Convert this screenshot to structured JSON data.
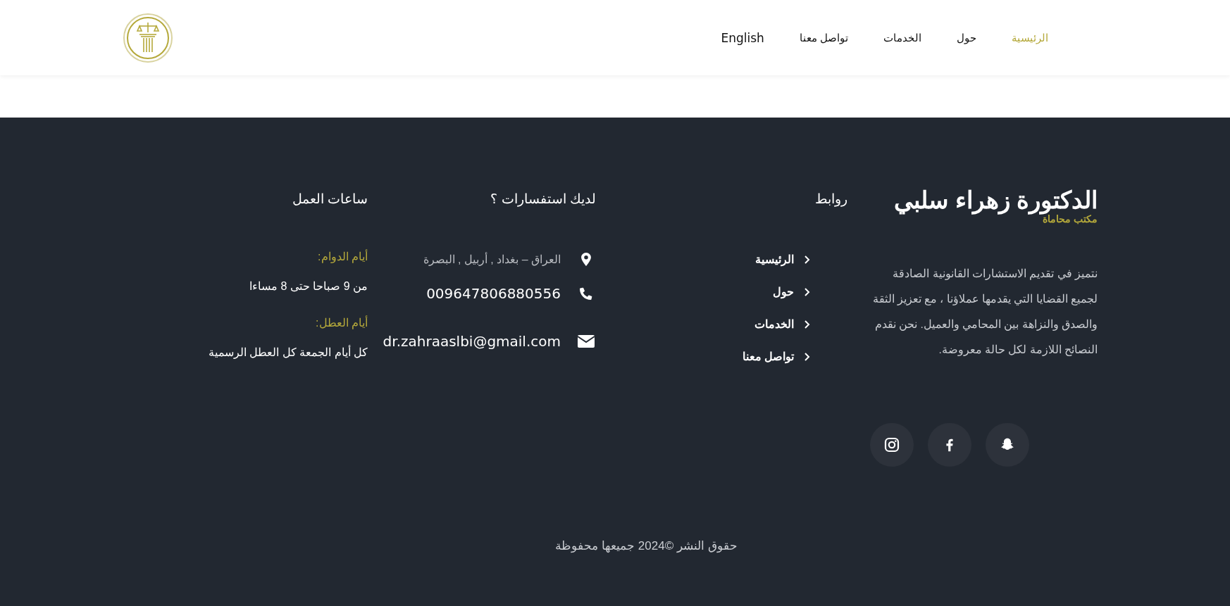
{
  "nav": {
    "items": [
      {
        "label": "الرئيسية",
        "selected": true
      },
      {
        "label": "حول",
        "selected": false
      },
      {
        "label": "الخدمات",
        "selected": false
      },
      {
        "label": "تواصل معنا",
        "selected": false
      },
      {
        "label": "English",
        "selected": false
      }
    ]
  },
  "brand": {
    "title": "الدكتورة زهراء سلبي",
    "subtitle": "مكتب محاماة",
    "description": "نتميز في تقديم الاستشارات القانونية الصادقة لجميع القضايا التي يقدمها عملاؤنا ، مع تعزيز الثقة والصدق والنزاهة بين المحامي والعميل. نحن نقدم النصائح اللازمة لكل حالة معروضة.",
    "socials": [
      {
        "kind": "snapchat"
      },
      {
        "kind": "facebook"
      },
      {
        "kind": "instagram"
      }
    ]
  },
  "links": {
    "heading": "روابط",
    "items": [
      "الرئيسية",
      "حول",
      "الخدمات",
      "تواصل معنا"
    ]
  },
  "contact": {
    "heading": "لديك استفسارات ؟",
    "items": [
      {
        "kind": "location",
        "text": "العراق – بغداد , أربيل , البصرة"
      },
      {
        "kind": "phone",
        "text": "009647806880556"
      },
      {
        "kind": "email",
        "text": "dr.zahraaslbi@gmail.com"
      }
    ]
  },
  "hours": {
    "heading": "ساعات العمل",
    "groups": [
      {
        "label": "أيام الدوام:",
        "value": "من 9 صباحا حتى 8 مساءا"
      },
      {
        "label": "أيام العطل:",
        "value": "كل أيام الجمعة كل العطل الرسمية"
      }
    ]
  },
  "copyright": "حقوق النشر ©2024 جميعها محفوظة"
}
